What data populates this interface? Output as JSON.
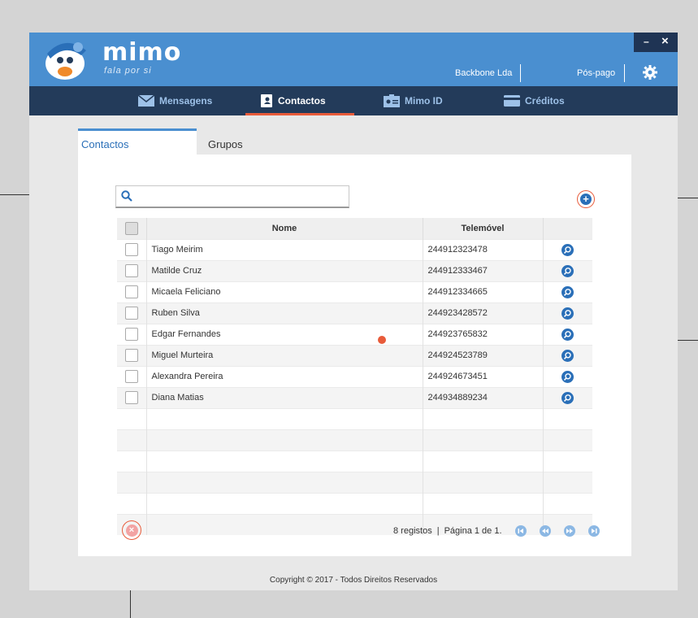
{
  "window": {
    "minimize_label": "–",
    "close_label": "×"
  },
  "brand": {
    "name": "mimo",
    "tagline": "fala por si"
  },
  "topbar": {
    "company": "Backbone Lda",
    "plan": "Pós-pago"
  },
  "nav": [
    {
      "label": "Mensagens",
      "icon": "envelope-icon",
      "active": false
    },
    {
      "label": "Contactos",
      "icon": "contacts-book-icon",
      "active": true
    },
    {
      "label": "Mimo ID",
      "icon": "id-card-icon",
      "active": false
    },
    {
      "label": "Créditos",
      "icon": "credit-card-icon",
      "active": false
    }
  ],
  "tabs": {
    "contacts": "Contactos",
    "groups": "Grupos"
  },
  "search": {
    "value": "",
    "placeholder": ""
  },
  "table": {
    "headers": {
      "name": "Nome",
      "mobile": "Telemóvel"
    },
    "rows": [
      {
        "name": "Tiago Meirim",
        "mobile": "244912323478"
      },
      {
        "name": "Matilde Cruz",
        "mobile": "244912333467"
      },
      {
        "name": "Micaela Feliciano",
        "mobile": "244912334665"
      },
      {
        "name": "Ruben Silva",
        "mobile": "244923428572"
      },
      {
        "name": "Edgar Fernandes",
        "mobile": "244923765832"
      },
      {
        "name": "Miguel Murteira",
        "mobile": "244924523789"
      },
      {
        "name": "Alexandra Pereira",
        "mobile": "244924673451"
      },
      {
        "name": "Diana Matias",
        "mobile": "244934889234"
      }
    ],
    "empty_rows": 6
  },
  "pager": {
    "records": "8 registos",
    "separator": "|",
    "page_info": "Página 1 de 1."
  },
  "footer": "Copyright © 2017 - Todos Direitos Reservados",
  "colors": {
    "accent": "#e85b3a",
    "primary": "#4a8fd0",
    "nav": "#233b5a",
    "link": "#2a6fb8"
  }
}
